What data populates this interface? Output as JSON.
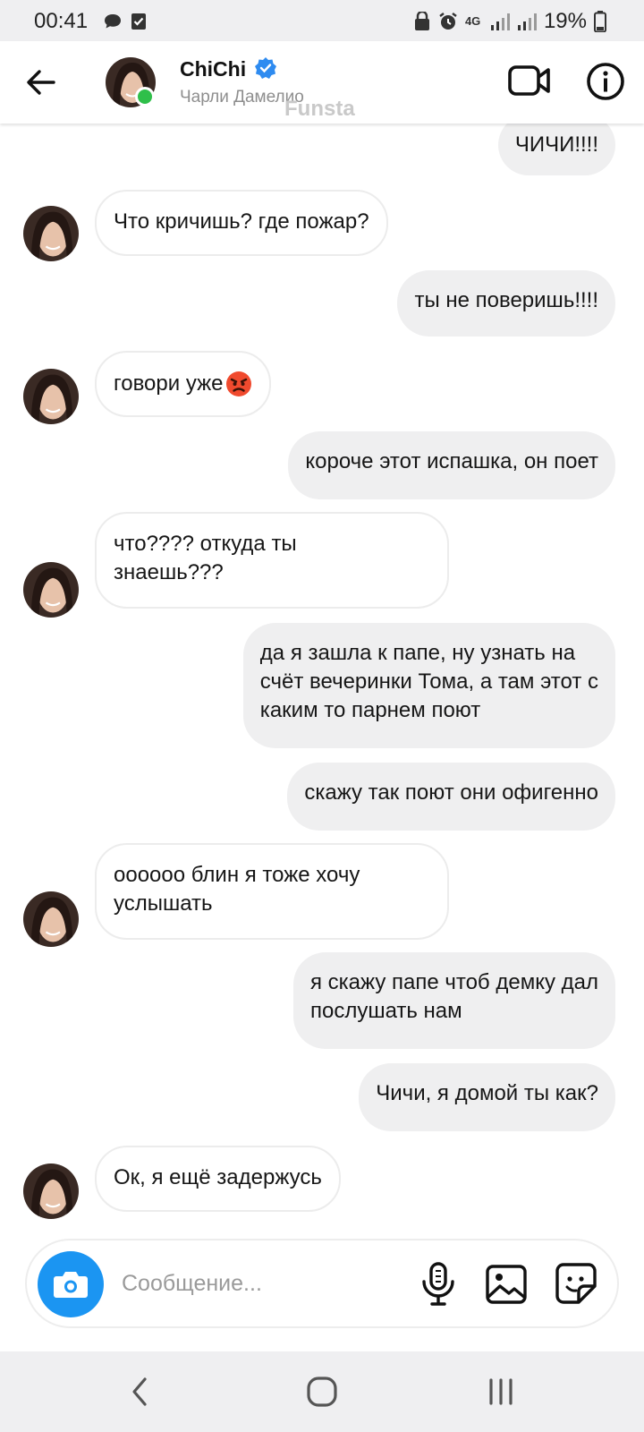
{
  "status_bar": {
    "time": "00:41",
    "network": "4G",
    "battery": "19%"
  },
  "header": {
    "name": "ChiChi",
    "subtitle": "Чарли Дамелио",
    "watermark": "Funsta",
    "online_color": "#2fbf4a",
    "verified_color": "#2e8bf0"
  },
  "messages": [
    {
      "side": "out",
      "text": "ЧИЧИ!!!!"
    },
    {
      "side": "in",
      "text": "Что кричишь? где пожар?"
    },
    {
      "side": "out",
      "text": "ты не поверишь!!!!"
    },
    {
      "side": "in",
      "text": "говори уже"
    },
    {
      "side": "out",
      "text": "короче этот испашка, он поет"
    },
    {
      "side": "in",
      "text": "что???? откуда ты\nзнаешь???"
    },
    {
      "side": "out",
      "text": "да я зашла к папе, ну узнать на\nсчёт вечеринки Тома, а там этот с\nкаким то парнем поют"
    },
    {
      "side": "out",
      "text": "скажу так поют они офигенно"
    },
    {
      "side": "in",
      "text": "оооооо блин я тоже хочу\nуслышать"
    },
    {
      "side": "out",
      "text": "я скажу папе чтоб демку дал\nпослушать нам"
    },
    {
      "side": "out",
      "text": "Чичи, я домой ты как?"
    },
    {
      "side": "in",
      "text": "Ок, я ещё задержусь"
    }
  ],
  "composer": {
    "placeholder": "Сообщение..."
  },
  "colors": {
    "accent": "#1b95f2",
    "outgoing_bubble": "#efeff0",
    "incoming_border": "#ececec"
  }
}
